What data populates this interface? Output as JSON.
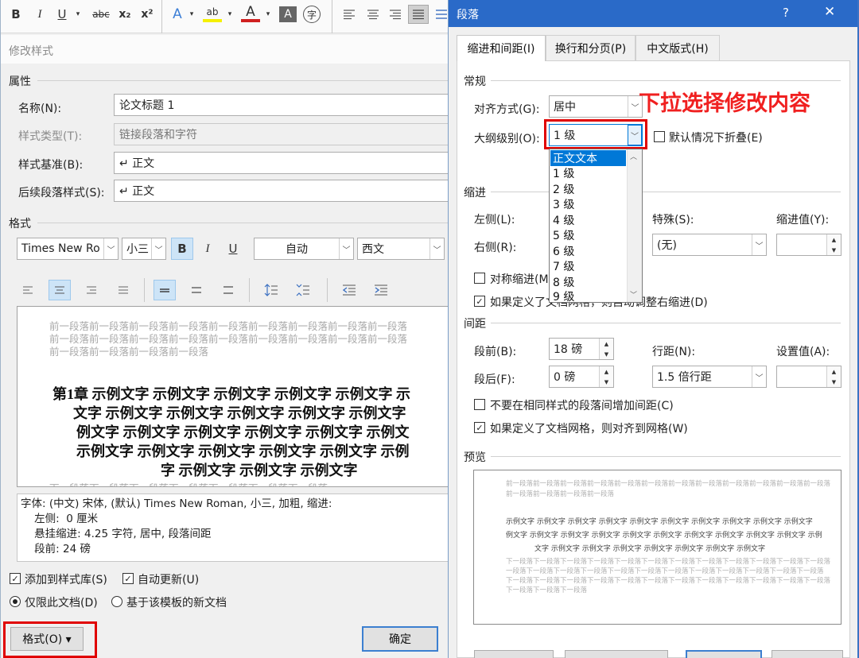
{
  "left_dialog": {
    "toolbar": {
      "bold": "B",
      "italic": "I",
      "underline": "U",
      "strike": "abc",
      "subscript": "x₂",
      "superscript": "x²",
      "text_effects": "A",
      "highlight": "ab",
      "font_color": "A",
      "char_shading": "A",
      "enclose": "字"
    },
    "title": "修改样式",
    "section_properties": "属性",
    "name_label": "名称(N):",
    "name_value": "论文标题 1",
    "style_type_label": "样式类型(T):",
    "style_type_value": "链接段落和字符",
    "based_on_label": "样式基准(B):",
    "based_on_value": "↵ 正文",
    "next_style_label": "后续段落样式(S):",
    "next_style_value": "↵ 正文",
    "section_format": "格式",
    "font_name": "Times New Ro",
    "font_size": "小三",
    "fmt_bold": "B",
    "fmt_italic": "I",
    "fmt_underline": "U",
    "color_value": "自动",
    "script_value": "西文",
    "preview": {
      "before_lines": [
        "前一段落前一段落前一段落前一段落前一段落前一段落前一段落前一段落前一段落",
        "前一段落前一段落前一段落前一段落前一段落前一段落前一段落前一段落前一段落",
        "前一段落前一段落前一段落前一段落"
      ],
      "main_lines": [
        "第1章 示例文字 示例文字 示例文字 示例文字 示例文字 示",
        "文字 示例文字 示例文字 示例文字 示例文字 示例文字",
        "例文字 示例文字 示例文字 示例文字 示例文字 示例文",
        "示例文字 示例文字 示例文字 示例文字 示例文字 示例",
        "字 示例文字 示例文字 示例文字"
      ],
      "after_line": "下一段落下一段落下一段落下一段落下一段落下一段落下一段落"
    },
    "description": [
      "字体: (中文) 宋体, (默认) Times New Roman, 小三, 加粗, 缩进:",
      "    左侧:  0 厘米",
      "    悬挂缩进: 4.25 字符, 居中, 段落间距",
      "    段前: 24 磅"
    ],
    "add_to_gallery_label": "添加到样式库(S)",
    "auto_update_label": "自动更新(U)",
    "only_this_doc_label": "仅限此文档(D)",
    "new_docs_label": "基于该模板的新文档",
    "format_button": "格式(O) ▾",
    "ok_button": "确定"
  },
  "right_dialog": {
    "title": "段落",
    "help": "?",
    "close": "✕",
    "tabs": [
      "缩进和间距(I)",
      "换行和分页(P)",
      "中文版式(H)"
    ],
    "general_section": "常规",
    "alignment_label": "对齐方式(G):",
    "alignment_value": "居中",
    "outline_label": "大纲级别(O):",
    "outline_value": "1 级",
    "collapse_label": "默认情况下折叠(E)",
    "outline_options": [
      "正文文本",
      "1 级",
      "2 级",
      "3 级",
      "4 级",
      "5 级",
      "6 级",
      "7 级",
      "8 级",
      "9 级"
    ],
    "indent_section": "缩进",
    "left_label": "左侧(L):",
    "right_label": "右侧(R):",
    "special_label": "特殊(S):",
    "special_value": "(无)",
    "indent_value_label": "缩进值(Y):",
    "mirror_indent_label": "对称缩进(M)",
    "auto_adjust_label": "如果定义了文档网格，则自动调整右缩进(D)",
    "spacing_section": "间距",
    "before_label": "段前(B):",
    "before_value": "18 磅",
    "after_label": "段后(F):",
    "after_value": "0 磅",
    "line_spacing_label": "行距(N):",
    "line_spacing_value": "1.5 倍行距",
    "at_label": "设置值(A):",
    "no_space_same_style_label": "不要在相同样式的段落间增加间距(C)",
    "snap_to_grid_label": "如果定义了文档网格，则对齐到网格(W)",
    "preview_section": "预览",
    "preview": {
      "before_lines": [
        "前一段落前一段落前一段落前一段落前一段落前一段落前一段落前一段落前一段落前一段落前一段落前一段落",
        "前一段落前一段落前一段落前一段落"
      ],
      "main_lines": [
        "示例文字 示例文字 示例文字 示例文字 示例文字 示例文字 示例文字 示例文字 示例文字 示例文字",
        "例文字 示例文字 示例文字 示例文字 示例文字 示例文字 示例文字 示例文字 示例文字 示例文字 示例",
        "文字 示例文字 示例文字 示例文字 示例文字 示例文字 示例文字 示例文字"
      ],
      "after_lines": [
        "下一段落下一段落下一段落下一段落下一段落下一段落下一段落下一段落下一段落下一段落下一段落下一段落",
        "一段落下一段落下一段落下一段落下一段落下一段落下一段落下一段落下一段落下一段落下一段落下一段落",
        "下一段落下一段落下一段落下一段落下一段落下一段落下一段落下一段落下一段落下一段落下一段落下一段落",
        "下一段落下一段落下一段落"
      ]
    }
  },
  "annotation": "下拉选择修改内容",
  "colors": {
    "titlebar": "#2a6ac8",
    "annotation": "#f02020",
    "selection": "#0078d7",
    "highlight_box": "#e00000"
  }
}
